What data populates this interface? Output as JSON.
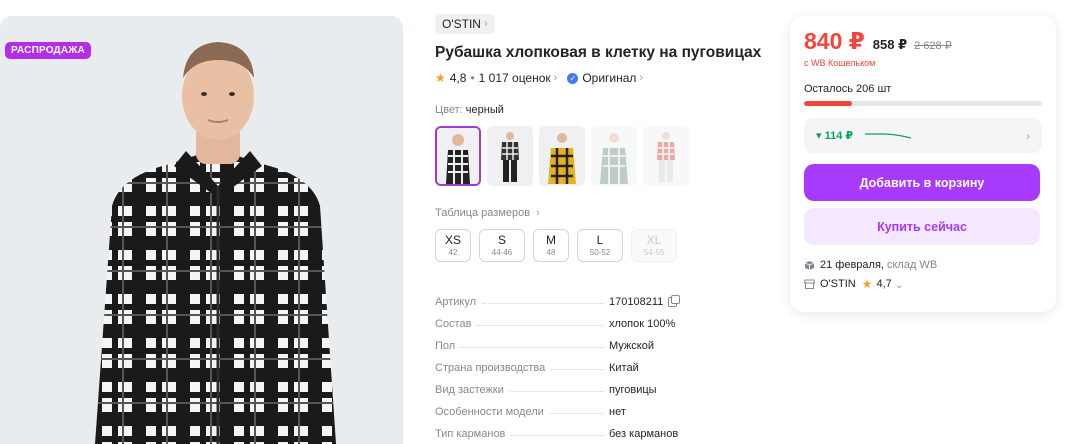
{
  "badge": "РАСПРОДАЖА",
  "brand": "O'STIN",
  "title": "Рубашка хлопковая в клетку на пуговицах",
  "rating": {
    "value": "4,8",
    "reviews": "1 017 оценок",
    "original": "Оригинал"
  },
  "color": {
    "label": "Цвет:",
    "value": "черный",
    "thumbnails": [
      "black-white-check",
      "black-white-check-full",
      "yellow-black-check",
      "grey-check",
      "red-check"
    ]
  },
  "sizes_link": "Таблица размеров",
  "sizes": [
    {
      "label": "XS",
      "ru": "42"
    },
    {
      "label": "S",
      "ru": "44-46"
    },
    {
      "label": "M",
      "ru": "48"
    },
    {
      "label": "L",
      "ru": "50-52"
    },
    {
      "label": "XL",
      "ru": "54-56"
    }
  ],
  "specs": [
    {
      "k": "Артикул",
      "v": "170108211"
    },
    {
      "k": "Состав",
      "v": "хлопок 100%"
    },
    {
      "k": "Пол",
      "v": "Мужской"
    },
    {
      "k": "Страна производства",
      "v": "Китай"
    },
    {
      "k": "Вид застежки",
      "v": "пуговицы"
    },
    {
      "k": "Особенности модели",
      "v": "нет"
    },
    {
      "k": "Тип карманов",
      "v": "без карманов"
    }
  ],
  "price": {
    "main": "840 ₽",
    "secondary": "858 ₽",
    "old": "2 628 ₽",
    "wallet": "с WB Кошельком"
  },
  "stock": {
    "text": "Осталось 206 шт",
    "level": 0.2
  },
  "trend": {
    "value": "▾ 114 ₽"
  },
  "buttons": {
    "cart": "Добавить в корзину",
    "buy": "Купить сейчас"
  },
  "delivery": {
    "date": "21 февраля,",
    "warehouse": "склад WB"
  },
  "seller": {
    "name": "O'STIN",
    "rating": "4,7"
  },
  "colors": {
    "accent": "#a73afd",
    "price": "#f1453d",
    "badge": "#b42ee8",
    "trend": "#0ba35a"
  }
}
